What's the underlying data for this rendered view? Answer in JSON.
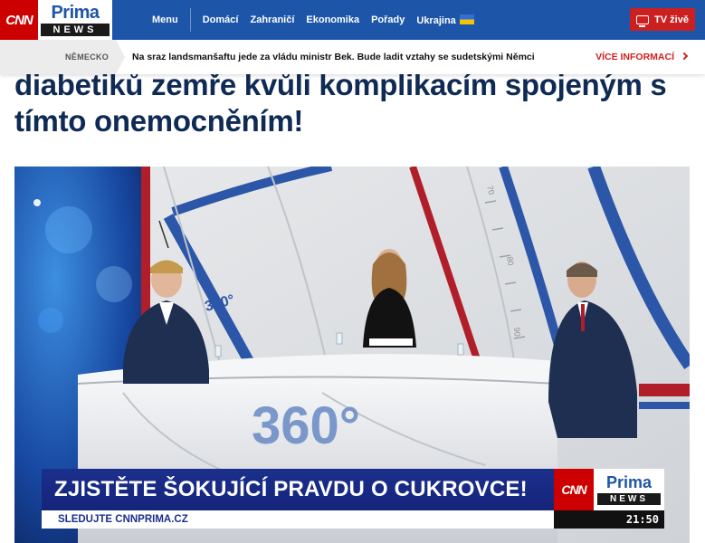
{
  "header": {
    "logo": {
      "cnn": "CNN",
      "prima": "Prima",
      "news": "NEWS"
    },
    "menu_label": "Menu",
    "nav": [
      "Domácí",
      "Zahraničí",
      "Ekonomika",
      "Pořady",
      "Ukrajina"
    ],
    "tv_button_label": "TV živě"
  },
  "ticker": {
    "tag": "NĚMECKO",
    "text": "Na sraz landsmanšaftu jede za vládu ministr Bek. Bude ladit vztahy se sudetskými Němci",
    "more_label": "VÍCE INFORMACÍ"
  },
  "article": {
    "headline_line1": "diabetiků zemře kvůli komplikacím spojeným s",
    "headline_line2": "tímto onemocněním!"
  },
  "video": {
    "studio_logo_text": "360°",
    "studio_logo_small": "360°",
    "lower_third": {
      "headline": "ZJISTĚTE ŠOKUJÍCÍ PRAVDU O CUKROVCE!",
      "subline": "SLEDUJTE CNNPRIMA.CZ",
      "logo_cnn": "CNN",
      "logo_prima": "Prima",
      "logo_news": "NEWS",
      "clock": "21:50"
    }
  }
}
